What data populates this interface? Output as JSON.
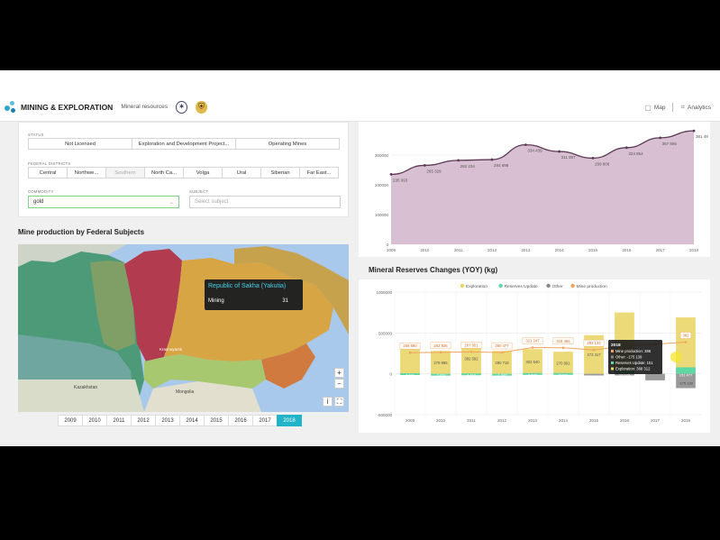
{
  "header": {
    "brand": "MINING & EXPLORATION",
    "subtitle": "Mineral resources",
    "map_label": "Map",
    "analytics_label": "Analytics",
    "icons": [
      "map-icon",
      "analytics-icon"
    ]
  },
  "filters": {
    "status_label": "STATUS",
    "status_options": [
      "Not Licensed",
      "Exploration and Development Project...",
      "Operating Mines"
    ],
    "districts_label": "FEDERAL DISTRICTS",
    "districts": [
      "Central",
      "Northwe...",
      "Southern",
      "North Ca...",
      "Volga",
      "Ural",
      "Siberian",
      "Far East..."
    ],
    "commodity_label": "COMMODITY",
    "commodity_value": "gold",
    "subject_label": "SUBJECT",
    "subject_placeholder": "Select subject"
  },
  "map_section": {
    "title": "Mine production by Federal Subjects",
    "tooltip_region": "Republic of Sakha (Yakutia)",
    "tooltip_metric": "Mining",
    "tooltip_value": "31",
    "places": [
      "Kazakhstan",
      "Mongolia",
      "Krasnoyarsk"
    ],
    "years": [
      "2009",
      "2010",
      "2011",
      "2012",
      "2013",
      "2014",
      "2015",
      "2016",
      "2017",
      "2018"
    ],
    "selected_year": "2018"
  },
  "reserves_title": "Mineral Reserves Changes (YOY) (kg)",
  "bar_tooltip": {
    "year": "2018",
    "lines": [
      "Mine production: 388",
      "Other: -175 139",
      "Reserves Update: 151",
      "Exploration: 368 312"
    ]
  },
  "chart_data": [
    {
      "type": "area",
      "x": [
        "2009",
        "2010",
        "2011",
        "2012",
        "2013",
        "2014",
        "2015",
        "2016",
        "2017",
        "2018"
      ],
      "values": [
        235093,
        265329,
        282234,
        284698,
        334439,
        311907,
        289808,
        324854,
        357895,
        381493
      ],
      "data_labels": [
        "235 093",
        "265 329",
        "282 234",
        "284 698",
        "334 439",
        "311 907",
        "289 808",
        "324 854",
        "357 895",
        "381 49"
      ],
      "yticks": [
        "0",
        "100000",
        "200000",
        "300000"
      ],
      "colors": {
        "fill": "#d8c0d2",
        "line": "#5c3a54"
      }
    },
    {
      "type": "bar",
      "title": "Mineral Reserves Changes (YOY) (kg)",
      "categories": [
        "2009",
        "2010",
        "2011",
        "2012",
        "2013",
        "2014",
        "2015",
        "2016",
        "2017",
        "2018"
      ],
      "yticks": [
        "-500000",
        "0",
        "500000",
        "1000000"
      ],
      "ylim": [
        -500000,
        1000000
      ],
      "series": [
        {
          "name": "Exploration",
          "color": "#e8d45f",
          "values": [
            300000,
            279985,
            382592,
            280718,
            302540,
            270991,
            473317,
            750000,
            0,
            690000
          ]
        },
        {
          "name": "Reserves Update",
          "color": "#5fd6a4",
          "values": [
            7181,
            -2050,
            4713,
            -1982,
            9573,
            9919,
            0,
            40000,
            0,
            80000
          ]
        },
        {
          "name": "Other",
          "color": "#888888",
          "values": [
            0,
            0,
            0,
            0,
            0,
            0,
            -20000,
            -20000,
            -80000,
            -175139
          ]
        },
        {
          "name": "Mine production",
          "color": "#f1a45f",
          "type": "line",
          "values": [
            258880,
            262926,
            267951,
            260477,
            321247,
            318455,
            293133,
            337000,
            362000,
            388000
          ]
        }
      ],
      "mine_labels": [
        "258 880",
        "262 926",
        "267 951",
        "260 477",
        "321 247",
        "318 455",
        "293 133",
        "",
        "",
        "382"
      ],
      "exploration_labels": [
        "",
        "279 985",
        "382 592",
        "280 718",
        "302 540",
        "270 991",
        "473 317",
        "",
        "",
        ""
      ],
      "update_labels": [
        "7 181",
        "-2 050",
        "4 713",
        "-1 982",
        "9 573",
        "9 919",
        "",
        "10 173",
        "",
        "151 477"
      ],
      "other_labels": [
        "",
        "",
        "",
        "",
        "",
        "",
        "",
        "",
        "",
        "-175 139"
      ],
      "legend": [
        "Exploration",
        "Reserves Update",
        "Other",
        "Mine production"
      ]
    }
  ]
}
